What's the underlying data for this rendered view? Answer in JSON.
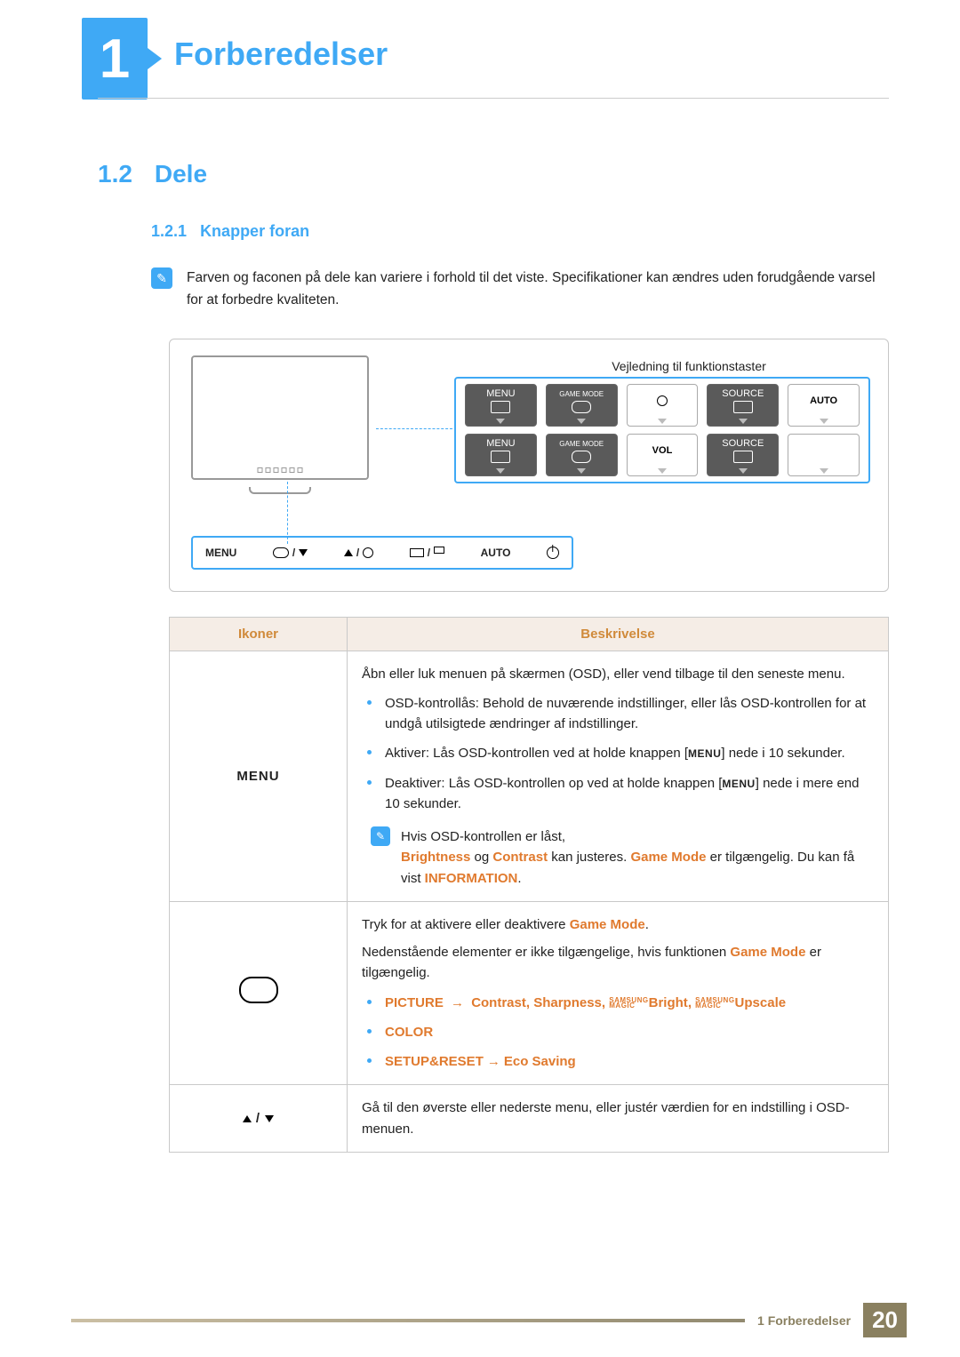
{
  "chapter": {
    "number": "1",
    "title": "Forberedelser"
  },
  "section": {
    "number": "1.2",
    "title": "Dele"
  },
  "subsection": {
    "number": "1.2.1",
    "title": "Knapper foran"
  },
  "note": "Farven og faconen på dele kan variere i forhold til det viste. Specifikationer kan ændres uden forudgående varsel for at forbedre kvaliteten.",
  "diagram": {
    "guide_label": "Vejledning til funktionstaster",
    "row1": {
      "c1": "MENU",
      "c2": "GAME MODE",
      "c4": "SOURCE",
      "c5": "AUTO"
    },
    "row2": {
      "c1": "MENU",
      "c2": "GAME MODE",
      "c3": "VOL",
      "c4": "SOURCE"
    },
    "strip": {
      "menu": "MENU",
      "auto": "AUTO"
    }
  },
  "table": {
    "head": {
      "icons": "Ikoner",
      "desc": "Beskrivelse"
    },
    "rows": {
      "menu": {
        "icon_label": "MENU",
        "p1": "Åbn eller luk menuen på skærmen (OSD), eller vend tilbage til den seneste menu.",
        "li1a": "OSD-kontrollås: Behold de nuværende indstillinger, eller lås OSD-kontrollen for at undgå utilsigtede ændringer af indstillinger.",
        "li2a": "Aktiver: Lås OSD-kontrollen ved at holde knappen [",
        "li2b": "] nede i 10 sekunder.",
        "li3a": "Deaktiver: Lås OSD-kontrollen op ved at holde knappen [",
        "li3b": "] nede i mere end 10 sekunder.",
        "note1": "Hvis OSD-kontrollen er låst,",
        "note2a": "Brightness",
        "note2b": " og ",
        "note2c": "Contrast",
        "note2d": " kan justeres. ",
        "note2e": "Game Mode",
        "note2f": " er tilgængelig. Du kan få vist ",
        "note2g": "INFORMATION",
        "note2h": "."
      },
      "game": {
        "p1a": "Tryk for at aktivere eller deaktivere ",
        "p1b": "Game Mode",
        "p1c": ".",
        "p2a": "Nedenstående elementer er ikke tilgængelige, hvis funktionen ",
        "p2b": "Game Mode",
        "p2c": " er tilgængelig.",
        "li1a": "PICTURE",
        "li1b": "Contrast",
        "li1c": "Sharpness",
        "li1d": "Bright",
        "li1e": "Upscale",
        "magic_top": "SAMSUNG",
        "magic_bot": "MAGIC",
        "li2": "COLOR",
        "li3a": "SETUP&RESET",
        "li3b": "Eco Saving"
      },
      "updown": {
        "p1": "Gå til den øverste eller nederste menu, eller justér værdien for en indstilling i OSD-menuen."
      }
    }
  },
  "footer": {
    "text": "1 Forberedelser",
    "page": "20"
  }
}
